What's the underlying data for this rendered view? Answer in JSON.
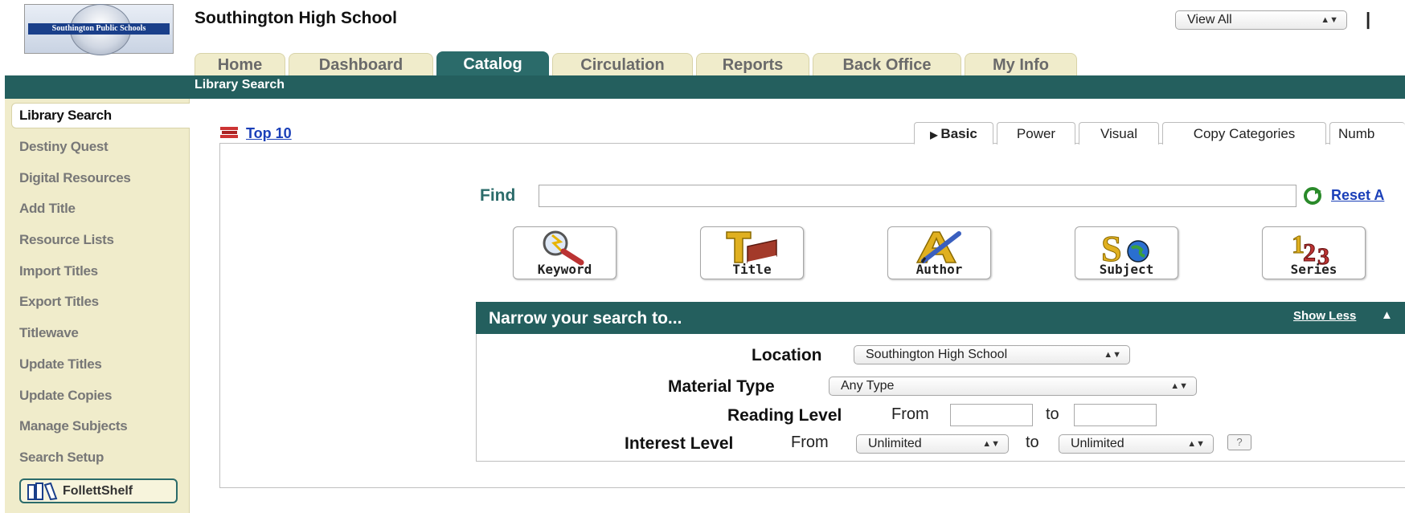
{
  "header": {
    "logo_text": "Southington Public Schools",
    "school_name": "Southington High School",
    "view_select": "View All",
    "separator": "|"
  },
  "tabs": [
    {
      "label": "Home",
      "active": false
    },
    {
      "label": "Dashboard",
      "active": false
    },
    {
      "label": "Catalog",
      "active": true
    },
    {
      "label": "Circulation",
      "active": false
    },
    {
      "label": "Reports",
      "active": false
    },
    {
      "label": "Back Office",
      "active": false
    },
    {
      "label": "My Info",
      "active": false
    }
  ],
  "breadcrumb": "Library Search",
  "sidebar": {
    "items": [
      "Library Search",
      "Destiny Quest",
      "Digital Resources",
      "Add Title",
      "Resource Lists",
      "Import Titles",
      "Export Titles",
      "Titlewave",
      "Update Titles",
      "Update Copies",
      "Manage Subjects",
      "Search Setup"
    ],
    "follett_button": "FollettShelf"
  },
  "main": {
    "top10_link": "Top 10",
    "search_tabs": [
      "Basic",
      "Power",
      "Visual",
      "Copy Categories",
      "Numb"
    ],
    "find_label": "Find",
    "find_value": "",
    "reset_link": "Reset A",
    "search_buttons": [
      "Keyword",
      "Title",
      "Author",
      "Subject",
      "Series"
    ],
    "narrow": {
      "title": "Narrow your search to...",
      "show_less": "Show Less",
      "location_label": "Location",
      "location_value": "Southington High School",
      "material_label": "Material Type",
      "material_value": "Any Type",
      "reading_label": "Reading Level",
      "from_label": "From",
      "to_label": "to",
      "interest_label": "Interest Level",
      "interest_from_value": "Unlimited",
      "interest_to_value": "Unlimited",
      "help_label": "?"
    }
  },
  "colors": {
    "teal": "#245f5e",
    "tab_beige": "#f0eccb",
    "link_blue": "#1a3fb8"
  }
}
